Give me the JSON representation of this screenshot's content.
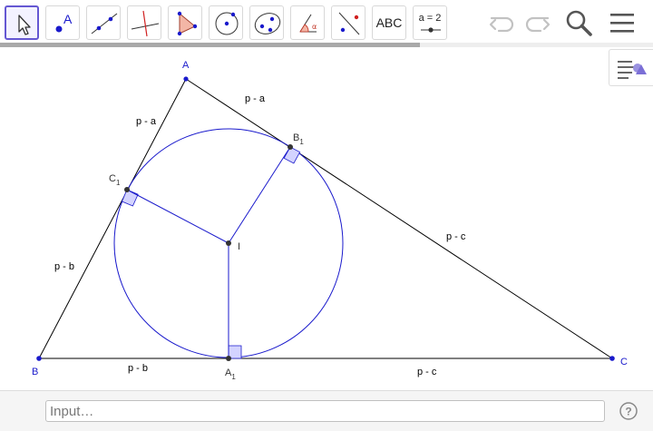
{
  "toolbar": {
    "tools": [
      {
        "name": "move-tool",
        "icon": "arrow-pointer-icon",
        "selected": true
      },
      {
        "name": "point-tool",
        "icon": "point-icon",
        "label": "A"
      },
      {
        "name": "line-tool",
        "icon": "line-through-two-points-icon"
      },
      {
        "name": "perpendicular-line-tool",
        "icon": "perpendicular-line-icon"
      },
      {
        "name": "polygon-tool",
        "icon": "polygon-icon"
      },
      {
        "name": "circle-tool",
        "icon": "circle-with-center-icon"
      },
      {
        "name": "ellipse-tool",
        "icon": "ellipse-icon"
      },
      {
        "name": "angle-tool",
        "icon": "angle-icon"
      },
      {
        "name": "reflect-tool",
        "icon": "reflect-about-line-icon"
      },
      {
        "name": "text-tool",
        "icon": "text-icon",
        "label": "ABC"
      },
      {
        "name": "slider-tool",
        "icon": "slider-icon",
        "label": "a = 2"
      }
    ],
    "actions": [
      "undo-icon",
      "redo-icon",
      "search-icon",
      "menu-icon"
    ]
  },
  "style_bar": {
    "icon": "style-bar-toggle-icon"
  },
  "construction": {
    "points": [
      {
        "id": "A",
        "label": "A",
        "sub": ""
      },
      {
        "id": "B",
        "label": "B",
        "sub": ""
      },
      {
        "id": "C",
        "label": "C",
        "sub": ""
      },
      {
        "id": "I",
        "label": "I",
        "sub": ""
      },
      {
        "id": "A1",
        "label": "A",
        "sub": "1"
      },
      {
        "id": "B1",
        "label": "B",
        "sub": "1"
      },
      {
        "id": "C1",
        "label": "C",
        "sub": "1"
      }
    ],
    "segment_labels": [
      {
        "id": "AC1",
        "text": "p - a"
      },
      {
        "id": "AB1",
        "text": "p - a"
      },
      {
        "id": "BC1",
        "text": "p - b"
      },
      {
        "id": "BA1",
        "text": "p - b"
      },
      {
        "id": "CB1",
        "text": "p - c"
      },
      {
        "id": "CA1",
        "text": "p - c"
      }
    ],
    "colors": {
      "points": "#1a1acc",
      "circle": "#1a1acc",
      "right_angle_fill": "#d3d3ff",
      "triangle": "#000000"
    }
  },
  "input_bar": {
    "placeholder": "Input…",
    "value": "",
    "help_icon": "help-icon"
  }
}
